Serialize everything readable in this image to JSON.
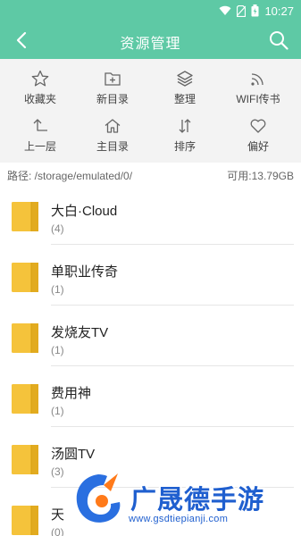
{
  "status_bar": {
    "time": "10:27",
    "icons": [
      "wifi-icon",
      "no-sim-icon",
      "battery-icon"
    ]
  },
  "app_bar": {
    "title": "资源管理",
    "back_icon": "back-arrow-icon",
    "search_icon": "search-icon"
  },
  "toolbar": {
    "items": [
      {
        "label": "收藏夹",
        "icon": "star-icon"
      },
      {
        "label": "新目录",
        "icon": "new-folder-icon"
      },
      {
        "label": "整理",
        "icon": "layers-icon"
      },
      {
        "label": "WIFI传书",
        "icon": "wifi-share-icon"
      },
      {
        "label": "上一层",
        "icon": "up-level-icon"
      },
      {
        "label": "主目录",
        "icon": "home-icon"
      },
      {
        "label": "排序",
        "icon": "sort-icon"
      },
      {
        "label": "偏好",
        "icon": "heart-icon"
      }
    ]
  },
  "path_bar": {
    "path": "路径: /storage/emulated/0/",
    "available": "可用:13.79GB"
  },
  "files": [
    {
      "name": "大白·Cloud",
      "count": "(4)",
      "icon": "folder-icon"
    },
    {
      "name": "单职业传奇",
      "count": "(1)",
      "icon": "folder-icon"
    },
    {
      "name": "发烧友TV",
      "count": "(1)",
      "icon": "folder-icon"
    },
    {
      "name": "费用神",
      "count": "(1)",
      "icon": "folder-icon"
    },
    {
      "name": "汤圆TV",
      "count": "(3)",
      "icon": "folder-icon"
    },
    {
      "name": "天",
      "count": "(0)",
      "icon": "folder-icon"
    }
  ],
  "watermark": {
    "name": "广晟德手游",
    "url": "www.gsdtiepianji.com"
  },
  "colors": {
    "primary": "#5ec9a5",
    "toolbar_bg": "#f3f3f3",
    "folder": "#f5c33b",
    "watermark_blue": "#1f5fcf"
  }
}
